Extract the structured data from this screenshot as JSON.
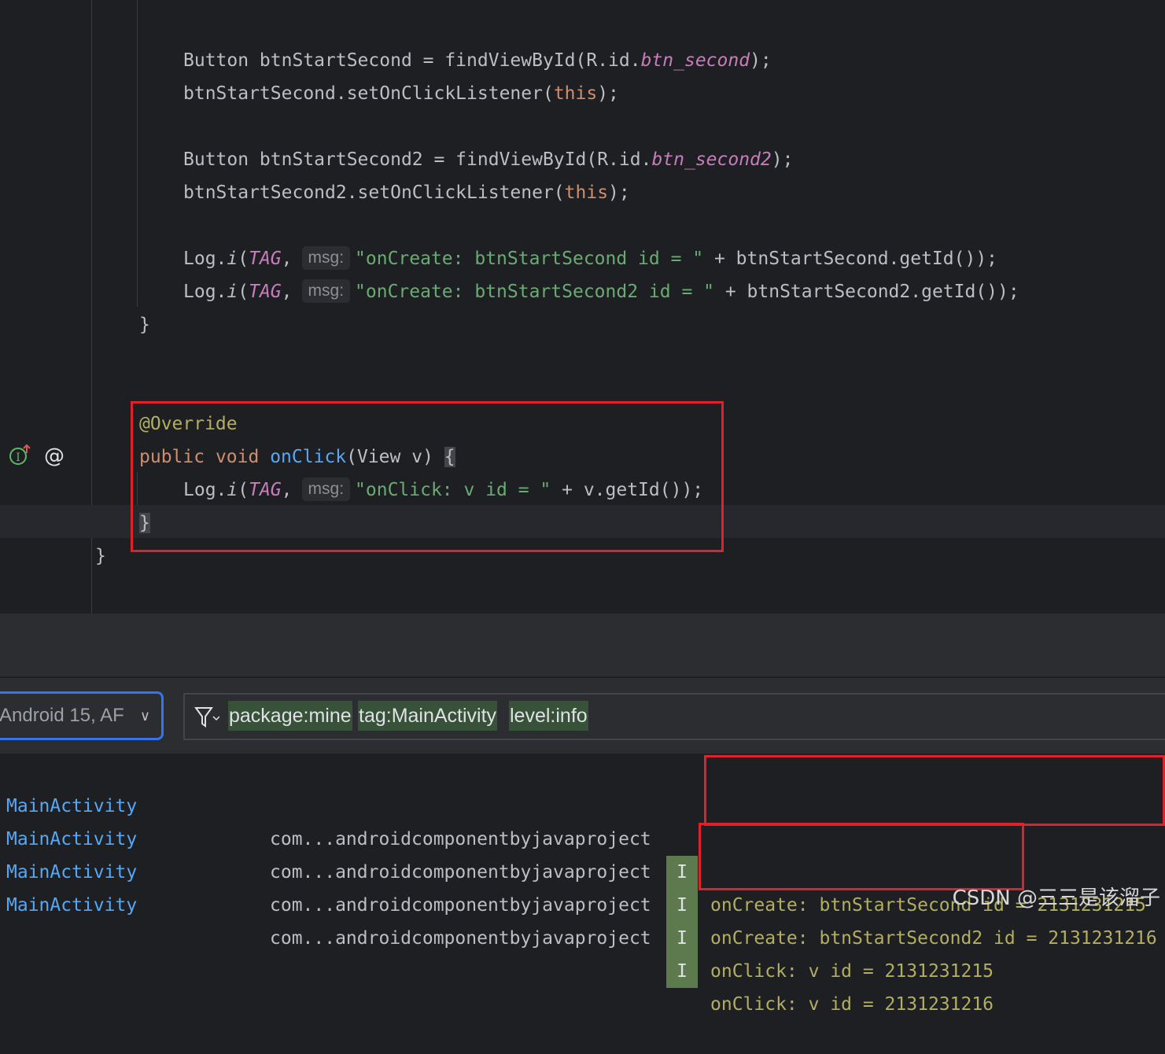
{
  "editor": {
    "lines": [
      {
        "id": "l1",
        "parts": [
          "Button btnStartSecond = findViewById(R.id.",
          "btn_second",
          ");"
        ]
      },
      {
        "id": "l2",
        "parts": [
          "btnStartSecond.setOnClickListener(",
          "this",
          ");"
        ]
      },
      {
        "id": "l3",
        "parts": [
          "Button btnStartSecond2 = findViewById(R.id.",
          "btn_second2",
          ");"
        ]
      },
      {
        "id": "l4",
        "parts": [
          "btnStartSecond2.setOnClickListener(",
          "this",
          ");"
        ]
      },
      {
        "id": "l5",
        "parts": [
          "Log.",
          "i",
          "(",
          "TAG",
          ",",
          "msg:",
          "\"onCreate: btnStartSecond id = \"",
          " + btnStartSecond.getId());"
        ]
      },
      {
        "id": "l6",
        "parts": [
          "Log.",
          "i",
          "(",
          "TAG",
          ",",
          "msg:",
          "\"onCreate: btnStartSecond2 id = \"",
          " + btnStartSecond2.getId());"
        ]
      },
      {
        "id": "l7",
        "parts": [
          "}"
        ]
      },
      {
        "id": "l8",
        "parts": [
          "@Override"
        ]
      },
      {
        "id": "l9",
        "parts": [
          "public",
          "void",
          "onClick",
          "(View v) ",
          "{"
        ]
      },
      {
        "id": "l10",
        "parts": [
          "Log.",
          "i",
          "(",
          "TAG",
          ",",
          "msg:",
          "\"onClick: v id = \"",
          " + v.getId());"
        ]
      },
      {
        "id": "l11",
        "parts": [
          "}"
        ]
      },
      {
        "id": "l12",
        "parts": [
          "}"
        ]
      }
    ]
  },
  "logcat": {
    "device_label": "Android 15, AF",
    "filter_chips": [
      "package:mine",
      "tag:MainActivity",
      "level:info"
    ],
    "rows": [
      {
        "tag": "MainActivity",
        "package": "com...androidcomponentbyjavaproject",
        "level": "I",
        "message": "onCreate: btnStartSecond id = 2131231215"
      },
      {
        "tag": "MainActivity",
        "package": "com...androidcomponentbyjavaproject",
        "level": "I",
        "message": "onCreate: btnStartSecond2 id = 2131231216"
      },
      {
        "tag": "MainActivity",
        "package": "com...androidcomponentbyjavaproject",
        "level": "I",
        "message": "onClick: v id = 2131231215"
      },
      {
        "tag": "MainActivity",
        "package": "com...androidcomponentbyjavaproject",
        "level": "I",
        "message": "onClick: v id = 2131231216"
      }
    ]
  },
  "watermark": "CSDN @三三是该溜子",
  "colors": {
    "keyword": "#cf8e6d",
    "function": "#56a8f5",
    "string": "#6aab73",
    "field": "#c77dbb",
    "annotation": "#b3ae60",
    "highlight_box": "#e0202a",
    "device_border": "#3574f0"
  }
}
